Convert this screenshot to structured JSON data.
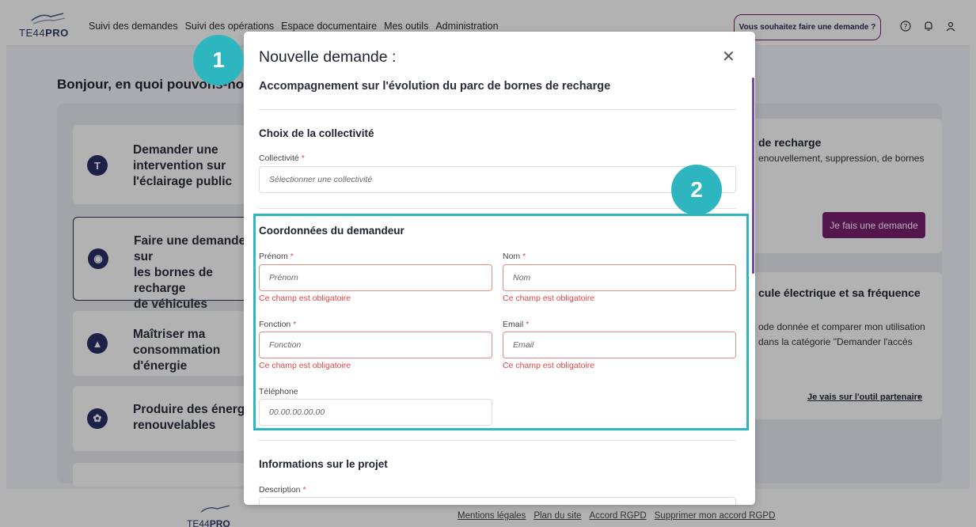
{
  "header": {
    "logo_prefix": "TE44",
    "logo_bold": "PRO",
    "nav": [
      "Suivi des demandes",
      "Suivi des opérations",
      "Espace documentaire",
      "Mes outils",
      "Administration"
    ],
    "cta": "Vous souhaitez faire une demande ?",
    "icons": [
      "help-icon",
      "bell-icon",
      "user-icon"
    ]
  },
  "page": {
    "greeting": "Bonjour, en quoi pouvons-nous vous aider ?",
    "cards": [
      {
        "label_lines": [
          "Demander une",
          "intervention sur",
          "l'éclairage public"
        ],
        "icon": "lamp-icon"
      },
      {
        "label_lines": [
          "Faire une demande sur",
          "les bornes de recharge",
          "de véhicules électriques"
        ],
        "icon": "car-icon"
      },
      {
        "label_lines": [
          "Maîtriser ma",
          "consommation d'énergie"
        ],
        "icon": "flame-icon"
      },
      {
        "label_lines": [
          "Produire des énergies",
          "renouvelables"
        ],
        "icon": "leaf-icon"
      }
    ],
    "right_card_1": {
      "title": "de recharge",
      "desc": "enouvellement, suppression, de bornes",
      "button": "Je fais une demande"
    },
    "right_card_2": {
      "title": "cule électrique et sa fréquence",
      "desc_lines": [
        "ode donnée et comparer mon utilisation",
        "dans la catégorie \"Demander l'accès"
      ],
      "link": "Je vais sur l'outil partenaire"
    }
  },
  "footer": {
    "logo_prefix": "TE44",
    "logo_bold": "PRO",
    "links": [
      "Mentions légales",
      "Plan du site",
      "Accord RGPD",
      "Supprimer mon accord RGPD"
    ]
  },
  "modal": {
    "title": "Nouvelle demande :",
    "subtitle": "Accompagnement sur l'évolution du parc de bornes de recharge",
    "section_collectivite": {
      "title": "Choix de la collectivité",
      "label": "Collectivité",
      "placeholder": "Sélectionner une collectivité"
    },
    "section_demandeur": {
      "title": "Coordonnées du demandeur",
      "prenom_label": "Prénom",
      "prenom_placeholder": "Prénom",
      "nom_label": "Nom",
      "nom_placeholder": "Nom",
      "fonction_label": "Fonction",
      "fonction_placeholder": "Fonction",
      "email_label": "Email",
      "email_placeholder": "Email",
      "telephone_label": "Téléphone",
      "telephone_placeholder": "00.00.00.00.00",
      "error_text": "Ce champ est obligatoire"
    },
    "section_projet": {
      "title": "Informations sur le projet",
      "description_label": "Description"
    },
    "required_mark": "*"
  },
  "annotations": {
    "step_1": "1",
    "step_2": "2",
    "highlight_color": "#2db6c0"
  }
}
